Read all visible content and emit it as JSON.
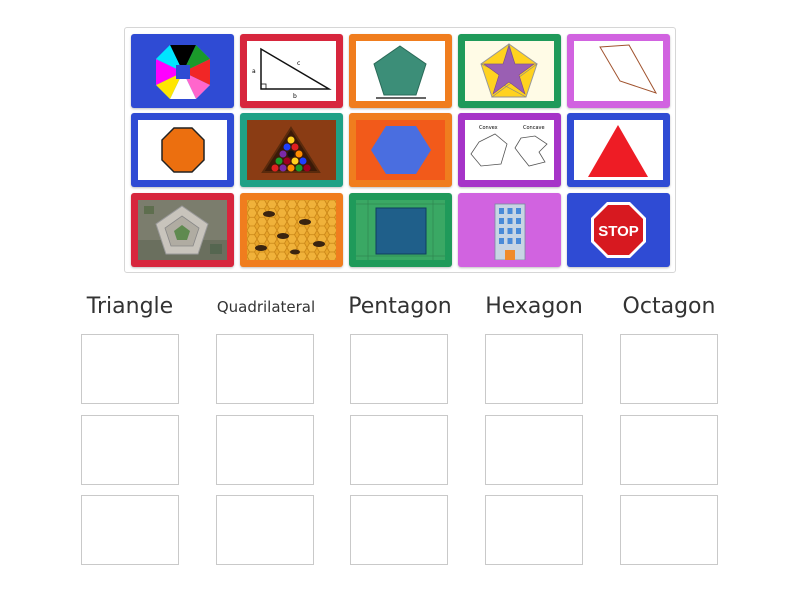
{
  "colors": {
    "blue": "#2f4bd4",
    "red": "#d7263d",
    "orange": "#f07d1e",
    "green": "#1f9a5a",
    "purple": "#a634c8",
    "magenta": "#d163e0",
    "teal": "#1fa186"
  },
  "tiles": [
    {
      "image": "colorful-octagon-pinwheel",
      "frame": "blue"
    },
    {
      "image": "right-triangle-diagram",
      "frame": "red"
    },
    {
      "image": "green-pentagon",
      "frame": "orange"
    },
    {
      "image": "star-in-pentagon",
      "frame": "green"
    },
    {
      "image": "quadrilateral-outline",
      "frame": "magenta"
    },
    {
      "image": "orange-octagon",
      "frame": "blue"
    },
    {
      "image": "billiard-balls-triangle-rack",
      "frame": "teal"
    },
    {
      "image": "blue-hexagon",
      "frame": "orange"
    },
    {
      "image": "convex-concave-polygons",
      "frame": "purple",
      "labels": [
        "Convex",
        "Concave"
      ]
    },
    {
      "image": "red-triangle",
      "frame": "blue"
    },
    {
      "image": "pentagon-building-aerial",
      "frame": "red"
    },
    {
      "image": "honeycomb-bees",
      "frame": "orange"
    },
    {
      "image": "green-square-on-grid",
      "frame": "green"
    },
    {
      "image": "office-building",
      "frame": "magenta"
    },
    {
      "image": "stop-sign",
      "frame": "blue",
      "text": "STOP"
    }
  ],
  "categories": [
    "Triangle",
    "Quadrilateral",
    "Pentagon",
    "Hexagon",
    "Octagon"
  ],
  "triangle_labels": {
    "a": "c",
    "b": "a",
    "c": "b"
  }
}
